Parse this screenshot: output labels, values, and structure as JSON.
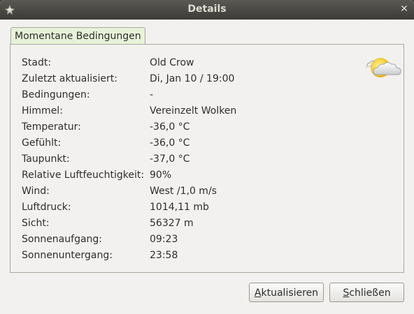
{
  "window": {
    "title": "Details",
    "app_icon": "weather-app-icon",
    "close_icon": "close-icon"
  },
  "tabs": [
    {
      "label": "Momentane Bedingungen",
      "active": true
    }
  ],
  "conditions": {
    "icon": "partly-cloudy-icon",
    "rows": [
      {
        "label": "Stadt:",
        "value": "Old Crow"
      },
      {
        "label": "Zuletzt aktualisiert:",
        "value": "Di, Jan 10 / 19:00"
      },
      {
        "label": "Bedingungen:",
        "value": "-"
      },
      {
        "label": "Himmel:",
        "value": "Vereinzelt Wolken"
      },
      {
        "label": "Temperatur:",
        "value": "-36,0 °C"
      },
      {
        "label": "Gefühlt:",
        "value": "-36,0 °C"
      },
      {
        "label": "Taupunkt:",
        "value": "-37,0 °C"
      },
      {
        "label": "Relative Luftfeuchtigkeit:",
        "value": "90%"
      },
      {
        "label": "Wind:",
        "value": "West /1,0 m/s"
      },
      {
        "label": "Luftdruck:",
        "value": "1014,11 mb"
      },
      {
        "label": "Sicht:",
        "value": "56327 m"
      },
      {
        "label": "Sonnenaufgang:",
        "value": "09:23"
      },
      {
        "label": "Sonnenuntergang:",
        "value": "23:58"
      }
    ]
  },
  "buttons": {
    "refresh": {
      "mnemonic": "A",
      "rest": "ktualisieren"
    },
    "close": {
      "mnemonic": "S",
      "rest": "chließen"
    }
  }
}
